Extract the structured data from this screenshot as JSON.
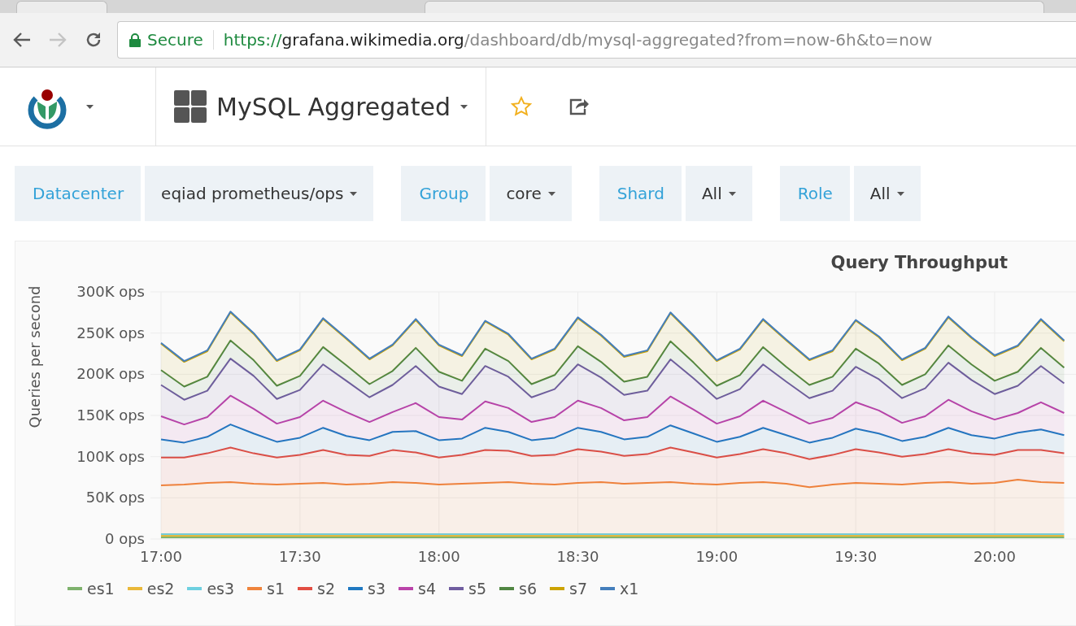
{
  "browser": {
    "back": {
      "disabled": false
    },
    "forward": {
      "disabled": true
    },
    "security_label": "Secure",
    "url": {
      "scheme": "https://",
      "host": "grafana.wikimedia.org",
      "path": "/dashboard/db/mysql-aggregated?from=now-6h&to=now"
    }
  },
  "dashboard": {
    "title": "MySQL Aggregated",
    "starred": false
  },
  "variables": [
    {
      "label": "Datacenter",
      "value": "eqiad prometheus/ops"
    },
    {
      "label": "Group",
      "value": "core"
    },
    {
      "label": "Shard",
      "value": "All"
    },
    {
      "label": "Role",
      "value": "All"
    }
  ],
  "panel": {
    "title": "Query Throughput",
    "chart_data": {
      "type": "area",
      "stacked": true,
      "grid": true,
      "ylabel": "Queries per second",
      "ylim": [
        0,
        300000
      ],
      "yticks": [
        {
          "value": 0,
          "label": "0 ops"
        },
        {
          "value": 50000,
          "label": "50K ops"
        },
        {
          "value": 100000,
          "label": "100K ops"
        },
        {
          "value": 150000,
          "label": "150K ops"
        },
        {
          "value": 200000,
          "label": "200K ops"
        },
        {
          "value": 250000,
          "label": "250K ops"
        },
        {
          "value": 300000,
          "label": "300K ops"
        }
      ],
      "categories": [
        "17:00",
        null,
        null,
        null,
        null,
        null,
        "17:30",
        null,
        null,
        null,
        null,
        null,
        "18:00",
        null,
        null,
        null,
        null,
        null,
        "18:30",
        null,
        null,
        null,
        null,
        null,
        "19:00",
        null,
        null,
        null,
        null,
        null,
        "19:30",
        null,
        null,
        null,
        null,
        null,
        "20:00",
        null,
        null,
        null
      ],
      "series": [
        {
          "name": "es1",
          "color": "#7eb26d",
          "values": [
            2000,
            2000,
            2000,
            2000,
            2000,
            2000,
            2000,
            2000,
            2000,
            2000,
            2000,
            2000,
            2000,
            2000,
            2000,
            2000,
            2000,
            2000,
            2000,
            2000,
            2000,
            2000,
            2000,
            2000,
            2000,
            2000,
            2000,
            2000,
            2000,
            2000,
            2000,
            2000,
            2000,
            2000,
            2000,
            2000,
            2000,
            2000,
            2000,
            2000
          ]
        },
        {
          "name": "es2",
          "color": "#eab839",
          "values": [
            2000,
            2000,
            2000,
            2000,
            2000,
            2000,
            2000,
            2000,
            2000,
            2000,
            2000,
            2000,
            2000,
            2000,
            2000,
            2000,
            2000,
            2000,
            2000,
            2000,
            2000,
            2000,
            2000,
            2000,
            2000,
            2000,
            2000,
            2000,
            2000,
            2000,
            2000,
            2000,
            2000,
            2000,
            2000,
            2000,
            2000,
            2000,
            2000,
            2000
          ]
        },
        {
          "name": "es3",
          "color": "#6ed0e0",
          "values": [
            2000,
            2000,
            2000,
            2000,
            2000,
            2000,
            2000,
            2000,
            2000,
            2000,
            2000,
            2000,
            2000,
            2000,
            2000,
            2000,
            2000,
            2000,
            2000,
            2000,
            2000,
            2000,
            2000,
            2000,
            2000,
            2000,
            2000,
            2000,
            2000,
            2000,
            2000,
            2000,
            2000,
            2000,
            2000,
            2000,
            2000,
            2000,
            2000,
            2000
          ]
        },
        {
          "name": "s1",
          "color": "#ef843c",
          "values": [
            59000,
            60000,
            62000,
            63000,
            61000,
            60000,
            61000,
            62000,
            60000,
            61000,
            63000,
            62000,
            60000,
            61000,
            62000,
            63000,
            61000,
            60000,
            62000,
            63000,
            61000,
            62000,
            63000,
            61000,
            60000,
            62000,
            63000,
            61000,
            57000,
            60000,
            62000,
            61000,
            60000,
            62000,
            63000,
            61000,
            62000,
            66000,
            63000,
            62000
          ]
        },
        {
          "name": "s2",
          "color": "#e24d42",
          "values": [
            34000,
            33000,
            36000,
            42000,
            37000,
            33000,
            35000,
            40000,
            36000,
            34000,
            39000,
            37000,
            33000,
            35000,
            40000,
            38000,
            34000,
            36000,
            41000,
            37000,
            34000,
            35000,
            42000,
            38000,
            33000,
            35000,
            40000,
            37000,
            34000,
            36000,
            41000,
            38000,
            34000,
            35000,
            40000,
            37000,
            34000,
            36000,
            39000,
            36000
          ]
        },
        {
          "name": "s3",
          "color": "#1f78c1",
          "values": [
            22000,
            18000,
            20000,
            28000,
            24000,
            19000,
            21000,
            27000,
            23000,
            19000,
            22000,
            26000,
            21000,
            20000,
            27000,
            23000,
            19000,
            21000,
            26000,
            24000,
            20000,
            21000,
            27000,
            23000,
            19000,
            21000,
            26000,
            22000,
            20000,
            21000,
            25000,
            23000,
            19000,
            21000,
            26000,
            22000,
            20000,
            21000,
            25000,
            22000
          ]
        },
        {
          "name": "s4",
          "color": "#ba43a9",
          "values": [
            28000,
            22000,
            24000,
            35000,
            30000,
            22000,
            25000,
            33000,
            29000,
            22000,
            24000,
            34000,
            28000,
            23000,
            32000,
            29000,
            22000,
            25000,
            33000,
            29000,
            23000,
            24000,
            35000,
            29000,
            22000,
            25000,
            33000,
            28000,
            23000,
            24000,
            32000,
            28000,
            22000,
            25000,
            34000,
            29000,
            23000,
            24000,
            33000,
            27000
          ]
        },
        {
          "name": "s5",
          "color": "#705da0",
          "values": [
            38000,
            30000,
            32000,
            45000,
            40000,
            30000,
            33000,
            44000,
            38000,
            30000,
            33000,
            45000,
            37000,
            31000,
            43000,
            38000,
            30000,
            34000,
            44000,
            37000,
            31000,
            32000,
            45000,
            38000,
            30000,
            33000,
            44000,
            37000,
            31000,
            33000,
            43000,
            38000,
            30000,
            34000,
            45000,
            38000,
            31000,
            33000,
            44000,
            36000
          ]
        },
        {
          "name": "s6",
          "color": "#508642",
          "values": [
            18000,
            16000,
            17000,
            22000,
            19000,
            16000,
            17000,
            21000,
            19000,
            16000,
            17000,
            22000,
            18000,
            16000,
            21000,
            19000,
            16000,
            17000,
            22000,
            19000,
            16000,
            17000,
            22000,
            19000,
            16000,
            17000,
            21000,
            18000,
            16000,
            17000,
            22000,
            19000,
            16000,
            17000,
            21000,
            19000,
            16000,
            17000,
            22000,
            19000
          ]
        },
        {
          "name": "s7",
          "color": "#cca300",
          "values": [
            32000,
            30000,
            31000,
            34000,
            32000,
            30000,
            31000,
            34000,
            32000,
            30000,
            31000,
            34000,
            32000,
            30000,
            33000,
            32000,
            30000,
            31000,
            34000,
            32000,
            30000,
            31000,
            34000,
            32000,
            30000,
            31000,
            33000,
            32000,
            30000,
            31000,
            34000,
            32000,
            30000,
            31000,
            34000,
            32000,
            30000,
            31000,
            34000,
            32000
          ]
        },
        {
          "name": "x1",
          "color": "#447ebc",
          "values": [
            1000,
            1000,
            1000,
            1000,
            1000,
            1000,
            1000,
            1000,
            1000,
            1000,
            1000,
            1000,
            1000,
            1000,
            1000,
            1000,
            1000,
            1000,
            1000,
            1000,
            1000,
            1000,
            1000,
            1000,
            1000,
            1000,
            1000,
            1000,
            1000,
            1000,
            1000,
            1000,
            1000,
            1000,
            1000,
            1000,
            1000,
            1000,
            1000,
            1000
          ]
        }
      ]
    }
  }
}
